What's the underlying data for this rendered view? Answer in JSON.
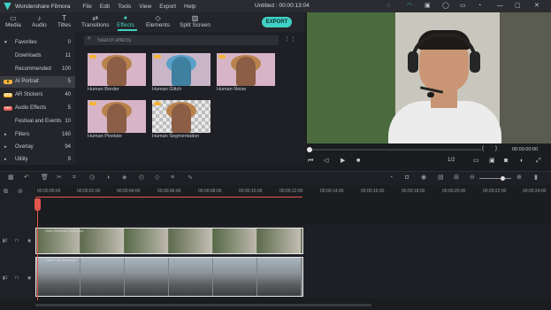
{
  "app": {
    "name": "Wondershare Filmora",
    "doc_title": "Untitled : 00:00:13:04"
  },
  "menu": [
    "File",
    "Edit",
    "Tools",
    "View",
    "Export",
    "Help"
  ],
  "tabs": [
    {
      "label": "Media",
      "icon": "folder-icon"
    },
    {
      "label": "Audio",
      "icon": "music-note-icon"
    },
    {
      "label": "Titles",
      "icon": "text-icon"
    },
    {
      "label": "Transitions",
      "icon": "transition-icon"
    },
    {
      "label": "Effects",
      "icon": "sparkle-icon",
      "active": true
    },
    {
      "label": "Elements",
      "icon": "shapes-icon"
    },
    {
      "label": "Split Screen",
      "icon": "split-screen-icon"
    }
  ],
  "export_label": "EXPORT",
  "nav": [
    {
      "label": "Favorites",
      "count": "0",
      "arrow": "▸",
      "icon": "heart-icon"
    },
    {
      "label": "Downloads",
      "count": "11"
    },
    {
      "label": "Recommended",
      "count": "100"
    },
    {
      "label": "AI Portrait",
      "count": "5",
      "selected": true,
      "badge": "crown"
    },
    {
      "label": "AR Stickers",
      "count": "40",
      "badge": "NEW"
    },
    {
      "label": "Audio Effects",
      "count": "5",
      "badge": "HOT"
    },
    {
      "label": "Festival and Events",
      "count": "10"
    },
    {
      "label": "Filters",
      "count": "160",
      "arrow": "▸"
    },
    {
      "label": "Overlay",
      "count": "94",
      "arrow": "▸"
    },
    {
      "label": "Utility",
      "count": "9",
      "arrow": "▸"
    }
  ],
  "search": {
    "placeholder": "Search effects"
  },
  "effects": [
    {
      "label": "Human Border"
    },
    {
      "label": "Human Glitch"
    },
    {
      "label": "Human Noise"
    },
    {
      "label": "Human Pixelate"
    },
    {
      "label": "Human Segmentation"
    }
  ],
  "player": {
    "timecode": "00:00:00:00",
    "ratio": "1/2"
  },
  "ruler": [
    "00:00:00:00",
    "00:00:02:00",
    "00:00:04:00",
    "00:00:06:00",
    "00:00:08:00",
    "00:00:10:00",
    "00:00:12:00",
    "00:00:14:00",
    "00:00:16:00",
    "00:00:18:00",
    "00:00:20:00",
    "00:00:22:00",
    "00:00:24:00"
  ],
  "clips": {
    "top": "Video Generator Video.mp4",
    "bottom": "Game Play Video.mp4"
  },
  "colors": {
    "accent": "#3fd1c3",
    "playhead": "#e4574c"
  }
}
